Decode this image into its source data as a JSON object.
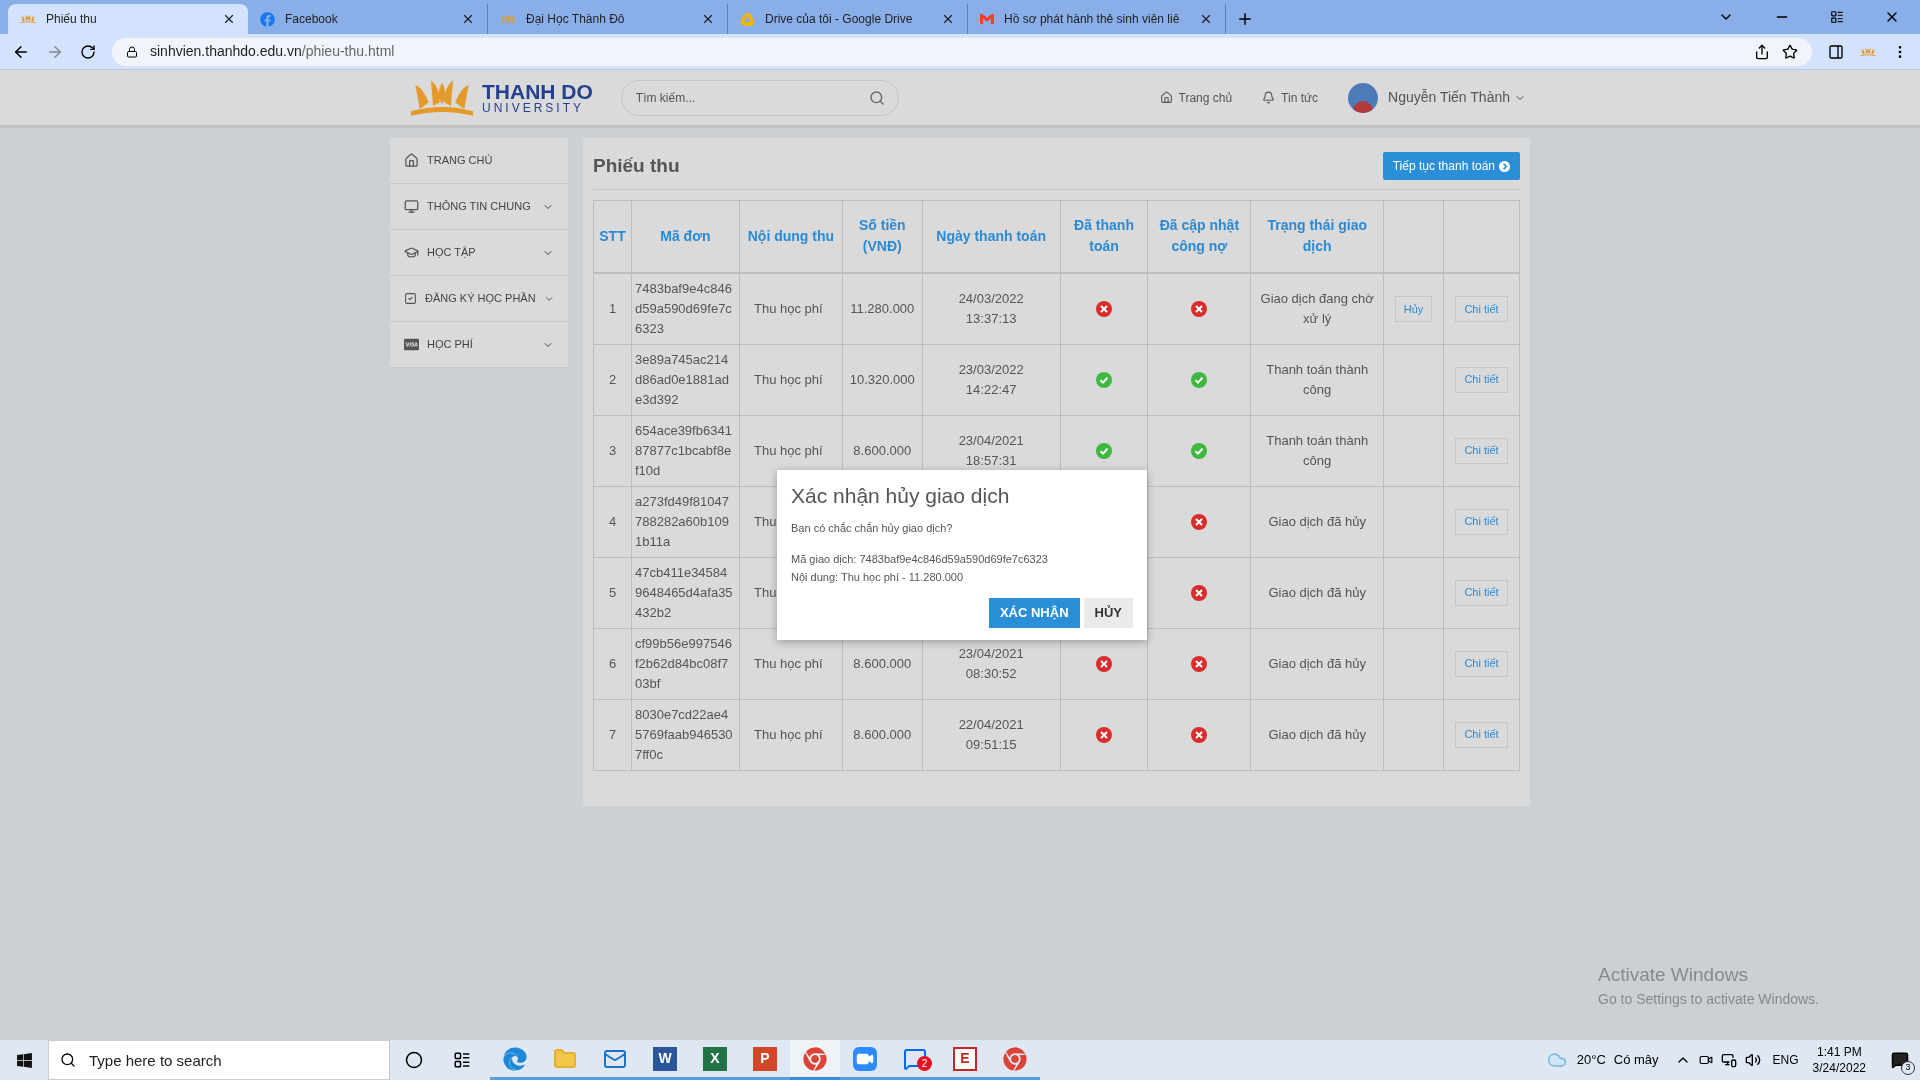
{
  "browser": {
    "tabs": [
      {
        "title": "Phiếu thu",
        "kind": "logo",
        "selected": true
      },
      {
        "title": "Facebook",
        "kind": "facebook",
        "selected": false
      },
      {
        "title": "Đại Học Thành Đô",
        "kind": "logo",
        "selected": false
      },
      {
        "title": "Drive của tôi - Google Drive",
        "kind": "drive",
        "selected": false
      },
      {
        "title": "Hồ sơ phát hành thẻ sinh viên liê",
        "kind": "gmail",
        "selected": false
      }
    ],
    "url_host": "sinhvien.thanhdo.edu.vn",
    "url_path": "/phieu-thu.html"
  },
  "header": {
    "logo_name": "THANH DO",
    "logo_sub": "UNIVERSITY",
    "search": {
      "placeholder": "Tìm kiếm..."
    },
    "nav": [
      {
        "label": "Trang chủ",
        "kind": "home"
      },
      {
        "label": "Tin tức",
        "kind": "bell"
      }
    ],
    "user": "Nguyễn Tiến Thành"
  },
  "sidebar": {
    "items": [
      {
        "label": "TRANG CHỦ",
        "kind": "home",
        "expandable": false
      },
      {
        "label": "THÔNG TIN CHUNG",
        "kind": "monitor",
        "expandable": true
      },
      {
        "label": "HỌC TẬP",
        "kind": "cap",
        "expandable": true
      },
      {
        "label": "ĐĂNG KÝ HỌC PHẦN",
        "kind": "check",
        "expandable": true
      },
      {
        "label": "HỌC PHÍ",
        "kind": "card",
        "expandable": true
      }
    ]
  },
  "page": {
    "title": "Phiếu thu",
    "continue_button": "Tiếp tục thanh toán"
  },
  "table": {
    "columns": [
      "STT",
      "Mã đơn",
      "Nội dung thu",
      "Số tiền (VNĐ)",
      "Ngày thanh toán",
      "Đã thanh toán",
      "Đã cập nhật công nợ",
      "Trạng thái giao dịch"
    ],
    "rows": [
      {
        "stt": "1",
        "code": "7483baf9e4c846d59a590d69fe7c6323",
        "content": "Thu học phí",
        "amount": "11.280.000",
        "date": "24/03/2022",
        "time": "13:37:13",
        "paid": false,
        "updated": false,
        "status": "Giao dịch đang chờ xử lý",
        "cancel": "Hủy",
        "detail": "Chi tiết"
      },
      {
        "stt": "2",
        "code": "3e89a745ac214d86ad0e1881ade3d392",
        "content": "Thu học phí",
        "amount": "10.320.000",
        "date": "23/03/2022",
        "time": "14:22:47",
        "paid": true,
        "updated": true,
        "status": "Thanh toán thành công",
        "detail": "Chi tiết"
      },
      {
        "stt": "3",
        "code": "654ace39fb634187877c1bcabf8ef10d",
        "content": "Thu học phí",
        "amount": "8.600.000",
        "date": "23/04/2021",
        "time": "18:57:31",
        "paid": true,
        "updated": true,
        "status": "Thanh toán thành công",
        "detail": "Chi tiết"
      },
      {
        "stt": "4",
        "code": "a273fd49f81047788282a60b1091b11a",
        "content": "Thu",
        "updated": false,
        "status": "Giao dịch đã hủy",
        "detail": "Chi tiết"
      },
      {
        "stt": "5",
        "code": "47cb411e345849648465d4afa35432b2",
        "content": "Thu",
        "updated": false,
        "status": "Giao dịch đã hủy",
        "detail": "Chi tiết"
      },
      {
        "stt": "6",
        "code": "cf99b56e997546f2b62d84bc08f703bf",
        "content": "Thu học phí",
        "amount": "8.600.000",
        "date": "23/04/2021",
        "time": "08:30:52",
        "paid": false,
        "updated": false,
        "status": "Giao dịch đã hủy",
        "detail": "Chi tiết"
      },
      {
        "stt": "7",
        "code": "8030e7cd22ae45769faab9465307ff0c",
        "content": "Thu học phí",
        "amount": "8.600.000",
        "date": "22/04/2021",
        "time": "09:51:15",
        "paid": false,
        "updated": false,
        "status": "Giao dịch đã hủy",
        "detail": "Chi tiết"
      }
    ]
  },
  "modal": {
    "title": "Xác nhận hủy giao dịch",
    "question": "Bạn có chắc chắn hủy giao dịch?",
    "lines": [
      "Mã giao dịch: 7483baf9e4c846d59a590d69fe7c6323",
      "Nội dung: Thu học phí - 11.280.000"
    ],
    "confirm": "XÁC NHẬN",
    "cancel": "HỦY"
  },
  "activation": {
    "title": "Activate Windows",
    "subtitle": "Go to Settings to activate Windows."
  },
  "taskbar": {
    "search": {
      "placeholder": "Type here to search"
    },
    "apps": [
      {
        "kind": "edge",
        "selected": false
      },
      {
        "kind": "folder",
        "selected": false
      },
      {
        "kind": "mail",
        "selected": false
      },
      {
        "kind": "word",
        "glyph": "W",
        "selected": false
      },
      {
        "kind": "excel",
        "glyph": "X",
        "selected": false
      },
      {
        "kind": "powerpoint",
        "glyph": "P",
        "selected": false
      },
      {
        "kind": "chrome",
        "selected": true
      },
      {
        "kind": "video",
        "selected": false
      },
      {
        "kind": "chat",
        "badge": "2",
        "selected": false
      },
      {
        "kind": "letter",
        "glyph": "E",
        "selected": false
      },
      {
        "kind": "chrome",
        "selected": false
      }
    ],
    "temperature": "20°C",
    "weather": "Có mây",
    "language": "ENG",
    "time": "1:41 PM",
    "date": "3/24/2022",
    "notifications": "3"
  }
}
